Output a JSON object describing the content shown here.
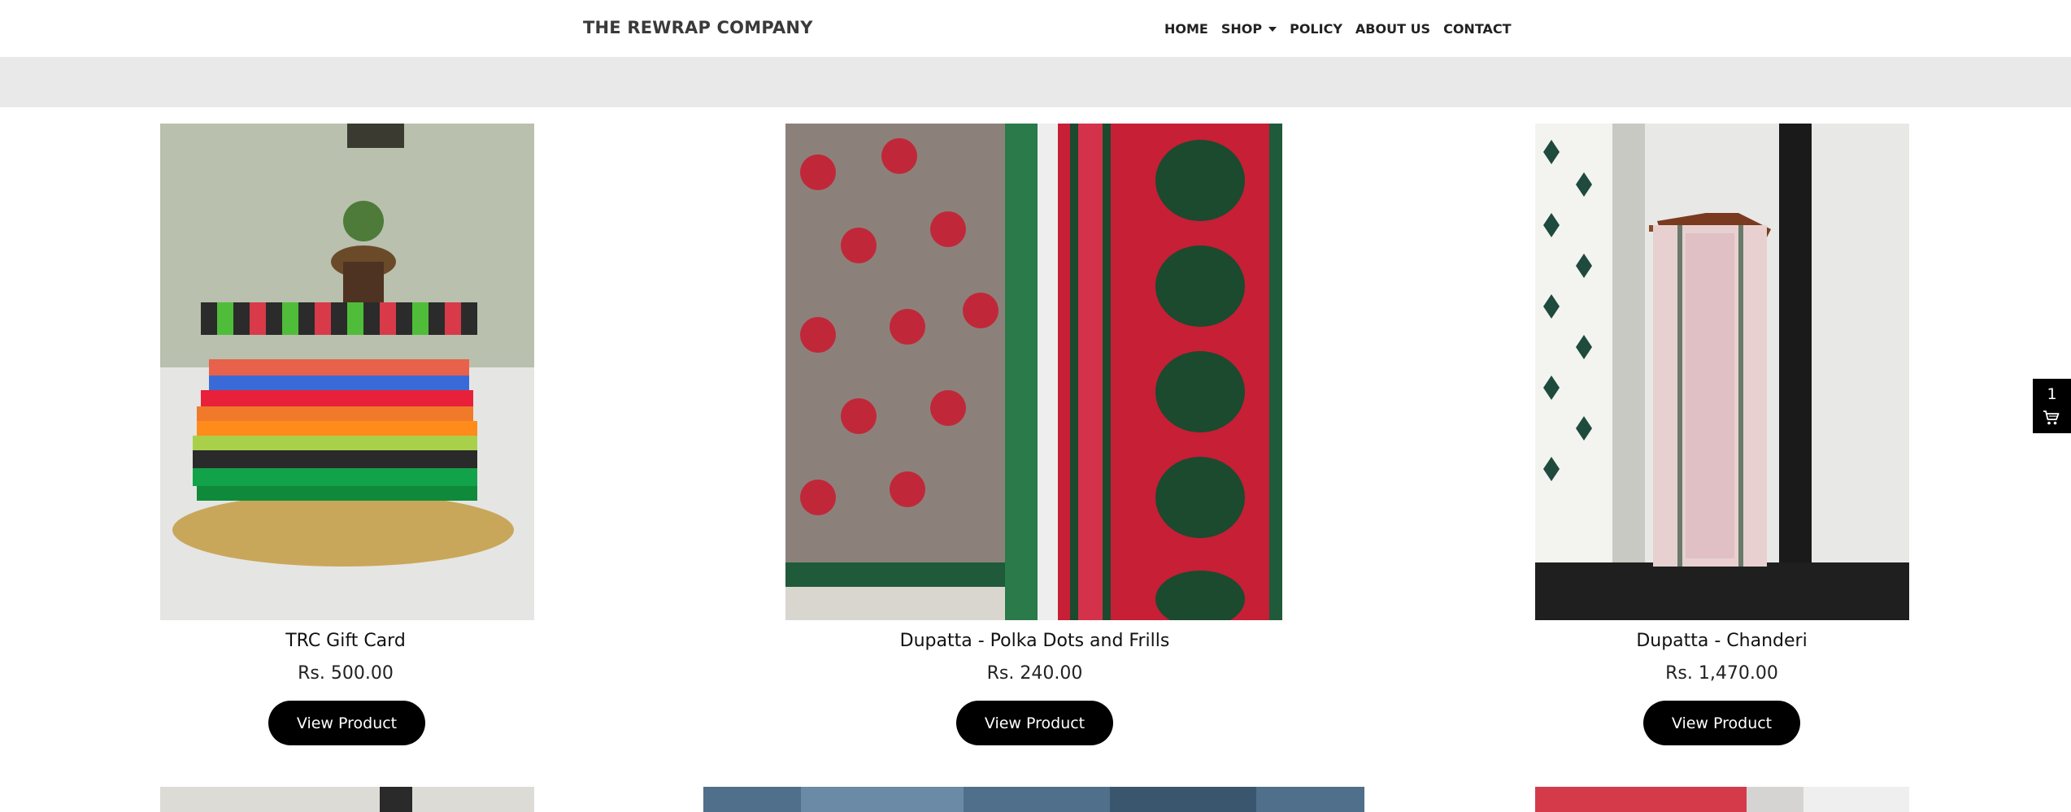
{
  "header": {
    "brand": "THE REWRAP COMPANY",
    "nav": {
      "home": "HOME",
      "shop": "SHOP",
      "policy": "POLICY",
      "about": "ABOUT US",
      "contact": "CONTACT"
    }
  },
  "products": [
    {
      "name": "TRC Gift Card",
      "price": "Rs. 500.00",
      "button": "View Product"
    },
    {
      "name": "Dupatta - Polka Dots and Frills",
      "price": "Rs. 240.00",
      "button": "View Product"
    },
    {
      "name": "Dupatta - Chanderi",
      "price": "Rs. 1,470.00",
      "button": "View Product"
    }
  ],
  "cart": {
    "count": "1",
    "icon": "cart-icon"
  },
  "colors": {
    "button_bg": "#000000",
    "banner_bg": "#e9e9e9",
    "brand_text": "#3a3a3a"
  }
}
